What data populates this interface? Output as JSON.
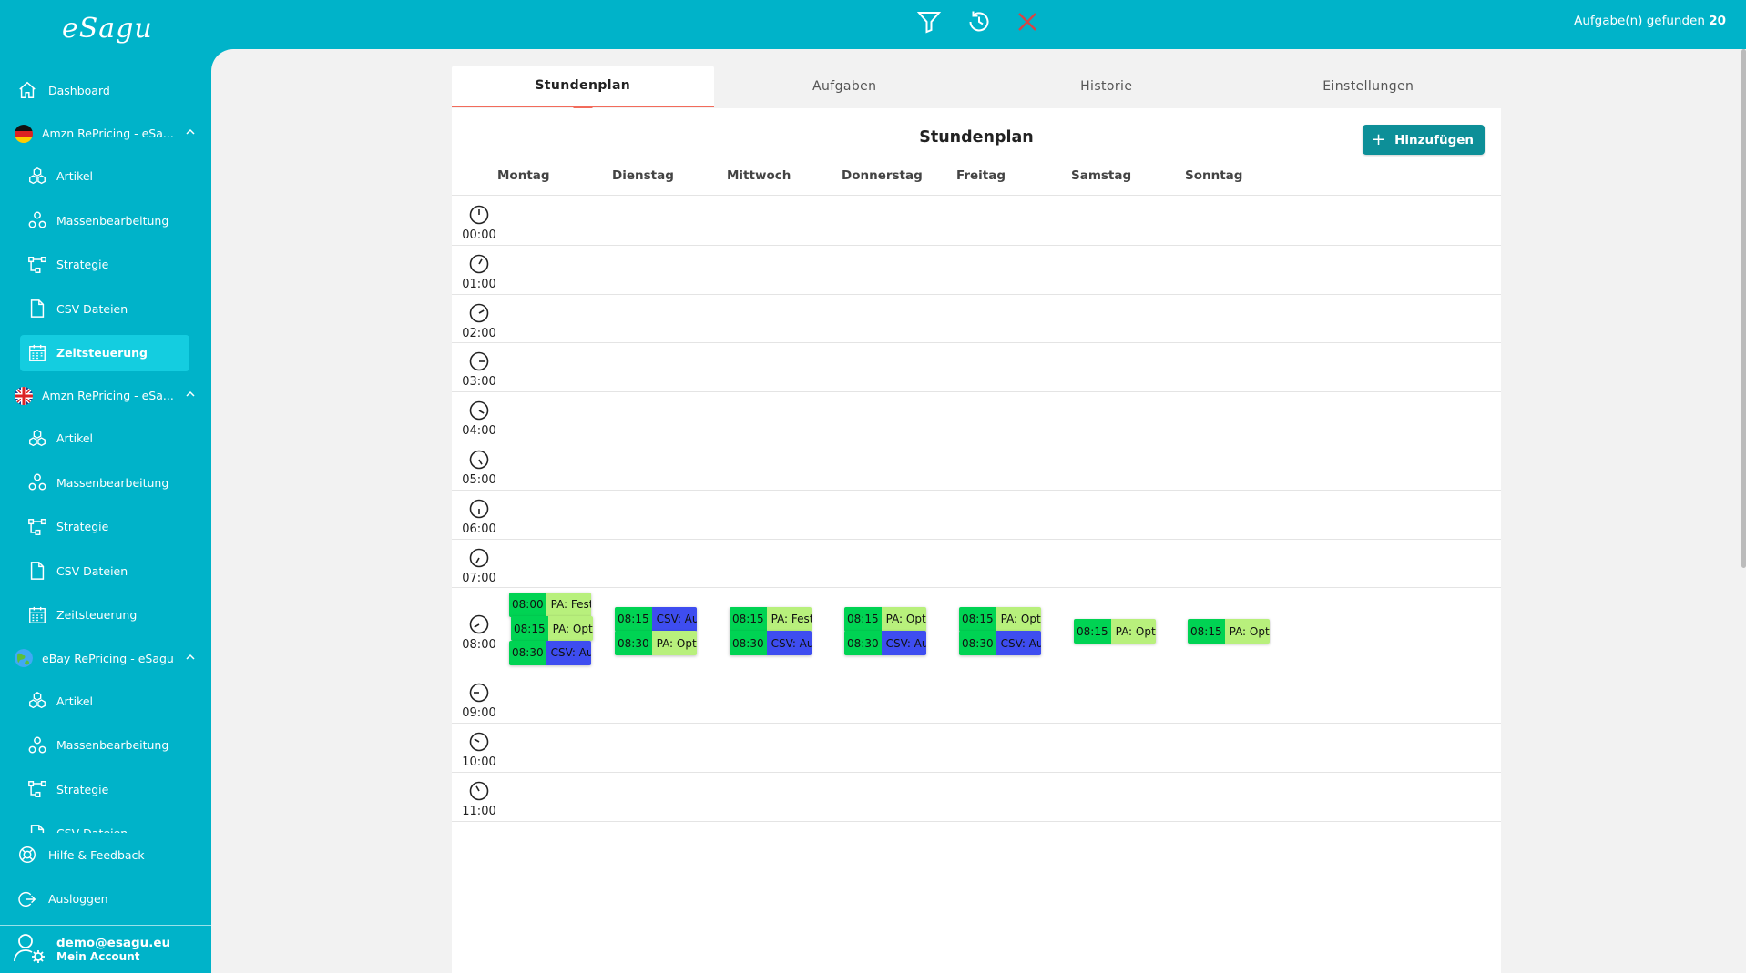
{
  "app": {
    "logo": "eSagu"
  },
  "topbar": {
    "filter_icon": "filter-icon",
    "history_icon": "history-icon",
    "close_icon": "close-icon",
    "found_label": "Aufgabe(n) gefunden",
    "found_count": "20",
    "close_color": "#d64545"
  },
  "sidebar": {
    "dashboard": "Dashboard",
    "groups": [
      {
        "label": "Amzn RePricing - eSa...",
        "flag": "de",
        "items": [
          "Artikel",
          "Massenbearbeitung",
          "Strategie",
          "CSV Dateien",
          "Zeitsteuerung"
        ],
        "active": 4
      },
      {
        "label": "Amzn RePricing - eSa...",
        "flag": "uk",
        "items": [
          "Artikel",
          "Massenbearbeitung",
          "Strategie",
          "CSV Dateien",
          "Zeitsteuerung"
        ],
        "active": -1
      },
      {
        "label": "eBay RePricing - eSagu",
        "flag": "world",
        "items": [
          "Artikel",
          "Massenbearbeitung",
          "Strategie",
          "CSV Dateien"
        ],
        "active": -1
      }
    ],
    "help": "Hilfe & Feedback",
    "logout": "Ausloggen",
    "user_email": "demo@esagu.eu",
    "user_account": "Mein Account"
  },
  "tabs": [
    "Stundenplan",
    "Aufgaben",
    "Historie",
    "Einstellungen"
  ],
  "active_tab": 0,
  "schedule": {
    "title": "Stundenplan",
    "add_label": "Hinzufügen",
    "days": [
      "Montag",
      "Dienstag",
      "Mittwoch",
      "Donnerstag",
      "Freitag",
      "Samstag",
      "Sonntag"
    ],
    "hours": [
      "00:00",
      "01:00",
      "02:00",
      "03:00",
      "04:00",
      "05:00",
      "06:00",
      "07:00",
      "08:00",
      "09:00",
      "10:00",
      "11:00"
    ],
    "events": [
      {
        "day": 0,
        "time": "08:00",
        "name": "PA: Festpr...",
        "kind": "pa"
      },
      {
        "day": 0,
        "time": "08:15",
        "name": "PA: Optim...",
        "kind": "pa"
      },
      {
        "day": 0,
        "time": "08:30",
        "name": "CSV: Auto...",
        "kind": "csv"
      },
      {
        "day": 1,
        "time": "08:15",
        "name": "CSV: Auto...",
        "kind": "csv"
      },
      {
        "day": 1,
        "time": "08:30",
        "name": "PA: Optim...",
        "kind": "pa"
      },
      {
        "day": 2,
        "time": "08:15",
        "name": "PA: Festpr...",
        "kind": "pa"
      },
      {
        "day": 2,
        "time": "08:30",
        "name": "CSV: Auto...",
        "kind": "csv"
      },
      {
        "day": 3,
        "time": "08:15",
        "name": "PA: Optim...",
        "kind": "pa"
      },
      {
        "day": 3,
        "time": "08:30",
        "name": "CSV: Auto...",
        "kind": "csv"
      },
      {
        "day": 4,
        "time": "08:15",
        "name": "PA: Optim...",
        "kind": "pa"
      },
      {
        "day": 4,
        "time": "08:30",
        "name": "CSV: Auto...",
        "kind": "csv"
      },
      {
        "day": 5,
        "time": "08:15",
        "name": "PA: Optim...",
        "kind": "pa"
      },
      {
        "day": 6,
        "time": "08:15",
        "name": "PA: Optim...",
        "kind": "pa"
      }
    ]
  },
  "colors": {
    "brand": "#00b3c9",
    "active_nav": "#14cde0",
    "button": "#0d8f98",
    "tab_accent": "#f26b5b",
    "event_time": "#00d353",
    "event_pa": "#b8f07c",
    "event_csv": "#3e4df0"
  }
}
